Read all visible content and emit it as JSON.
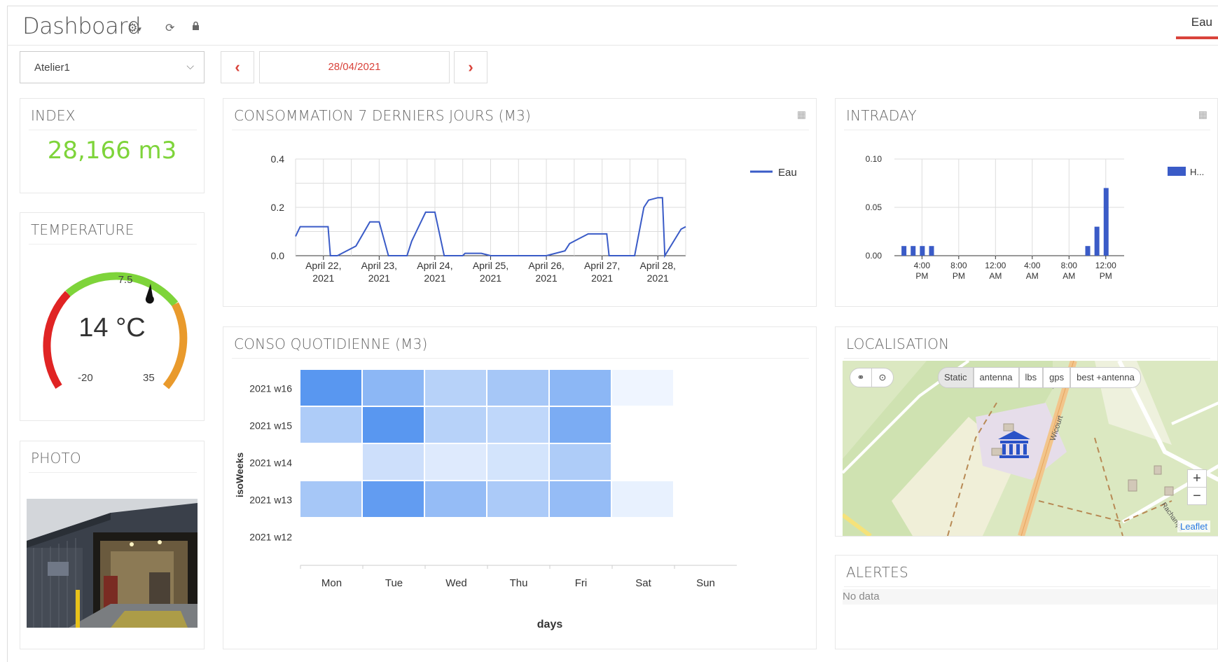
{
  "header": {
    "title": "Dashboard",
    "settings_icon": "gear-icon",
    "refresh_icon": "refresh-icon",
    "lock_icon": "lock-icon",
    "active_tab": "Eau"
  },
  "controls": {
    "site_select": "Atelier1",
    "date": "28/04/2021"
  },
  "index": {
    "title": "INDEX",
    "value": "28,166 m3"
  },
  "temperature": {
    "title": "TEMPERATURE",
    "value": "14 °C",
    "min_label": "-20",
    "max_label": "35",
    "mid_label": "7.5",
    "min": -20,
    "max": 35,
    "current": 14
  },
  "photo": {
    "title": "PHOTO"
  },
  "weekly": {
    "title": "CONSOMMATION 7 DERNIERS JOURS (M3)",
    "legend": "Eau",
    "y_ticks": [
      "0.4",
      "0.2",
      "0.0"
    ],
    "x_ticks": [
      [
        "April 22,",
        "2021"
      ],
      [
        "April 23,",
        "2021"
      ],
      [
        "April 24,",
        "2021"
      ],
      [
        "April 25,",
        "2021"
      ],
      [
        "April 26,",
        "2021"
      ],
      [
        "April 27,",
        "2021"
      ],
      [
        "April 28,",
        "2021"
      ]
    ]
  },
  "intraday": {
    "title": "INTRADAY",
    "legend": "H...",
    "y_ticks": [
      "0.10",
      "0.05",
      "0.00"
    ],
    "x_ticks": [
      [
        "4:00",
        "PM"
      ],
      [
        "8:00",
        "PM"
      ],
      [
        "12:00",
        "AM"
      ],
      [
        "4:00",
        "AM"
      ],
      [
        "8:00",
        "AM"
      ],
      [
        "12:00",
        "PM"
      ]
    ]
  },
  "daily": {
    "title": "CONSO QUOTIDIENNE (M3)",
    "ylabel": "isoWeeks",
    "xlabel": "days",
    "weeks": [
      "2021 w16",
      "2021 w15",
      "2021 w14",
      "2021 w13",
      "2021 w12"
    ],
    "days": [
      "Mon",
      "Tue",
      "Wed",
      "Thu",
      "Fri",
      "Sat",
      "Sun"
    ]
  },
  "map": {
    "title": "LOCALISATION",
    "modes": [
      "Static",
      "antenna",
      "lbs",
      "gps",
      "best +antenna"
    ],
    "zoom_in": "+",
    "zoom_out": "−",
    "attribution": "Leaflet",
    "street": "Wicourt",
    "street2": "Rachamps"
  },
  "alerts": {
    "title": "ALERTES",
    "empty": "No data"
  },
  "colors": {
    "accent": "#d9433b",
    "index_green": "#7ed43a",
    "series_blue": "#3a5bc7"
  },
  "chart_data": [
    {
      "type": "line",
      "title": "CONSOMMATION 7 DERNIERS JOURS (M3)",
      "ylim": [
        0,
        0.4
      ],
      "series": [
        {
          "name": "Eau",
          "x": [
            "2021-04-21 12:00",
            "2021-04-21 14:00",
            "2021-04-21 18:00",
            "2021-04-22 02:00",
            "2021-04-22 03:00",
            "2021-04-22 06:00",
            "2021-04-22 14:00",
            "2021-04-22 20:00",
            "2021-04-23 00:00",
            "2021-04-23 04:00",
            "2021-04-23 12:00",
            "2021-04-23 14:00",
            "2021-04-23 16:00",
            "2021-04-23 20:00",
            "2021-04-24 00:00",
            "2021-04-24 04:00",
            "2021-04-24 12:00",
            "2021-04-24 13:00",
            "2021-04-24 20:00",
            "2021-04-25 00:00",
            "2021-04-25 12:00",
            "2021-04-25 13:00",
            "2021-04-26 00:00",
            "2021-04-26 08:00",
            "2021-04-26 10:00",
            "2021-04-26 14:00",
            "2021-04-26 18:00",
            "2021-04-26 20:00",
            "2021-04-27 02:00",
            "2021-04-27 03:00",
            "2021-04-27 14:00",
            "2021-04-27 18:00",
            "2021-04-27 20:00",
            "2021-04-28 00:00",
            "2021-04-28 02:00",
            "2021-04-28 03:00",
            "2021-04-28 10:00",
            "2021-04-28 12:00"
          ],
          "values": [
            0.08,
            0.12,
            0.12,
            0.12,
            0.0,
            0.0,
            0.04,
            0.14,
            0.14,
            0.0,
            0.0,
            0.06,
            0.1,
            0.18,
            0.18,
            0.0,
            0.0,
            0.01,
            0.01,
            0.0,
            0.0,
            0.0,
            0.0,
            0.02,
            0.05,
            0.07,
            0.09,
            0.09,
            0.09,
            0.0,
            0.0,
            0.2,
            0.23,
            0.24,
            0.24,
            0.0,
            0.11,
            0.12
          ]
        }
      ]
    },
    {
      "type": "bar",
      "title": "INTRADAY",
      "ylim": [
        0,
        0.1
      ],
      "series": [
        {
          "name": "H...",
          "x": [
            "14:00",
            "16:00",
            "17:00",
            "10:00",
            "11:00",
            "12:00",
            "15:00"
          ],
          "values": [
            0.01,
            0.01,
            0.01,
            0.01,
            0.03,
            0.07,
            0.01
          ]
        }
      ]
    },
    {
      "type": "heatmap",
      "title": "CONSO QUOTIDIENNE (M3)",
      "xlabel": "days",
      "ylabel": "isoWeeks",
      "x": [
        "Mon",
        "Tue",
        "Wed",
        "Thu",
        "Fri",
        "Sat",
        "Sun"
      ],
      "y": [
        "2021 w16",
        "2021 w15",
        "2021 w14",
        "2021 w13",
        "2021 w12"
      ],
      "values": [
        [
          0.9,
          0.6,
          0.35,
          0.45,
          0.6,
          0.02,
          null
        ],
        [
          0.4,
          0.9,
          0.35,
          0.3,
          0.7,
          null,
          null
        ],
        [
          null,
          0.22,
          0.12,
          0.18,
          0.4,
          null,
          null
        ],
        [
          0.45,
          0.85,
          0.55,
          0.42,
          0.55,
          0.06,
          null
        ],
        [
          null,
          null,
          null,
          null,
          null,
          null,
          null
        ]
      ]
    }
  ]
}
